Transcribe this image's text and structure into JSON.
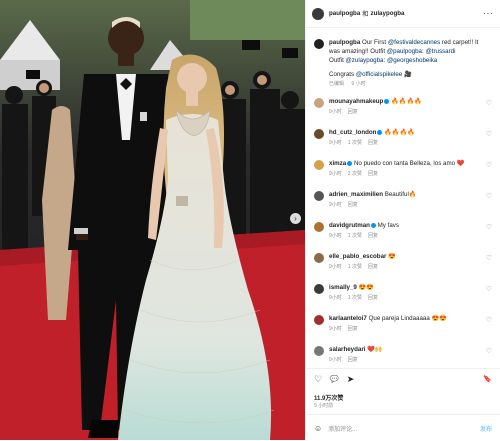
{
  "header": {
    "username": "paulpogba",
    "collab_joiner": "和",
    "collab_user": "zulaypogba",
    "more": "···"
  },
  "caption": {
    "username": "paulpogba",
    "text_1": "Our First",
    "tag_1": "@festivaldecannes",
    "text_2": "red carpet!! It was amazing!! Outfit",
    "tag_2": "@paulpogba",
    "text_3": ":",
    "tag_3": "@trussardi",
    "text_4": "Outfit",
    "tag_4": "@zulaypogba",
    "text_5": ":",
    "tag_5": "@georgeshobeika",
    "congrats": "Congrats",
    "tag_6": "@officialspikelee",
    "congrats_emoji": "🎥",
    "edited": "已编辑",
    "time": "9 小时"
  },
  "comments": [
    {
      "user": "mounayahmakeup",
      "verified": true,
      "text": "🔥🔥🔥🔥",
      "time": "9小时",
      "likes": "",
      "reply": "回复",
      "color": "#c8a47e"
    },
    {
      "user": "hd_cutz_london",
      "verified": true,
      "text": "🔥🔥🔥🔥",
      "time": "9小时",
      "likes": "1 次赞",
      "reply": "回复",
      "color": "#6a4a2a"
    },
    {
      "user": "ximza",
      "verified": true,
      "text": "No puedo con tanta Belleza, los amo ❤️",
      "time": "9小时",
      "likes": "2 次赞",
      "reply": "回复",
      "color": "#d4a04a"
    },
    {
      "user": "adrien_maximilien",
      "verified": false,
      "text": "Beautiful🔥",
      "time": "9小时",
      "likes": "",
      "reply": "回复",
      "color": "#555555"
    },
    {
      "user": "davidgrutman",
      "verified": true,
      "text": "My favs",
      "time": "9小时",
      "likes": "1 次赞",
      "reply": "回复",
      "color": "#b07030"
    },
    {
      "user": "elle_pablo_escobar",
      "verified": false,
      "text": "😍",
      "time": "9小时",
      "likes": "1 次赞",
      "reply": "回复",
      "color": "#8a6a4a"
    },
    {
      "user": "ismally_9",
      "verified": false,
      "text": "😍😍",
      "time": "9小时",
      "likes": "1 次赞",
      "reply": "回复",
      "color": "#3a3a3a"
    },
    {
      "user": "karlaanteloi7",
      "verified": false,
      "text": "Que pareja Lindaaaaa 😍😍",
      "time": "9小时",
      "likes": "",
      "reply": "回复",
      "color": "#a03030"
    },
    {
      "user": "salarheydari",
      "verified": false,
      "text": "❤️🙌",
      "time": "9小时",
      "likes": "",
      "reply": "回复",
      "color": "#777777"
    }
  ],
  "actions": {
    "like": "♡",
    "comment": "💬",
    "share": "➤",
    "save": "🔖"
  },
  "likes_count": "11.9万次赞",
  "post_time": "9 小时前",
  "add_comment": {
    "emoji": "☺",
    "placeholder": "添加评论...",
    "post": "发布"
  },
  "colors": {
    "accent": "#0095f6",
    "link": "#00376b",
    "muted": "#8e8e8e",
    "carpet": "#c0202a"
  },
  "icons": {
    "nav_next": "chevron-right-icon",
    "heart": "heart-icon",
    "verified": "verified-badge-icon"
  }
}
